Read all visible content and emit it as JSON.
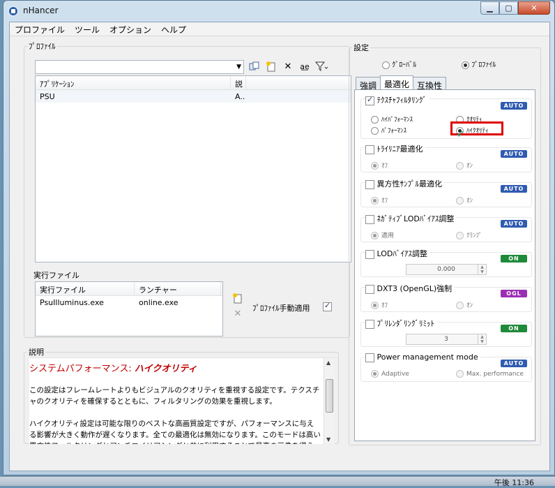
{
  "window": {
    "title": "nHancer",
    "min_label": "▁",
    "max_label": "▢",
    "close_label": "✕"
  },
  "menu": [
    {
      "label": "プロファイル"
    },
    {
      "label": "ツール"
    },
    {
      "label": "オプション"
    },
    {
      "label": "ヘルプ"
    }
  ],
  "profile": {
    "legend": "ﾌﾟﾛﾌｧｲﾙ",
    "combo_value": "",
    "columns": [
      "ｱﾌﾟﾘｹｰｼｮﾝ",
      "説"
    ],
    "rows": [
      {
        "app": "PSU",
        "desc": "A.."
      }
    ]
  },
  "exe": {
    "title": "実行ファイル",
    "columns": [
      "実行ファイル",
      "ランチャー"
    ],
    "rows": [
      {
        "exe": "PsuIlluminus.exe",
        "launcher": "online.exe"
      }
    ],
    "manual_label": "ﾌﾟﾛﾌｧｲﾙ手動適用",
    "manual_checked": true
  },
  "description": {
    "legend": "説明",
    "heading_prefix": "システムパフォーマンス: ",
    "heading_value": "ハイクオリティ",
    "p1": "この設定はフレームレートよりもビジュアルのクオリティを重視する設定です。テクスチャのクオリティを確保するとともに、フィルタリングの効果を重視します。",
    "p2": "ハイクオリティ設定は可能な限りのベストな高画質設定ですが、パフォーマンスに与える影響が大きく動作が遅くなります。全ての最適化は無効になります。このモードは高い異方性フィルタリングとアンチエイリアシングと共に利用することで最高の画像を得られます。"
  },
  "settings": {
    "legend": "設定",
    "scope_global": "ｸﾞﾛｰﾊﾞﾙ",
    "scope_profile": "ﾌﾟﾛﾌｧｲﾙ",
    "scope_selected": "profile",
    "tabs": [
      {
        "label": "強調",
        "active": false
      },
      {
        "label": "最適化",
        "active": true
      },
      {
        "label": "互換性",
        "active": false
      }
    ],
    "items": [
      {
        "title": "ﾃｸｽﾁｬﾌｨﾙﾀﾘﾝｸﾞ",
        "checked": true,
        "badge": "AUTO",
        "options": [
          "ﾊｲﾊﾟﾌｫｰﾏﾝｽ",
          "ｸｵﾘﾃｨ",
          "ﾊﾟﾌｫｰﾏﾝｽ",
          "ﾊｲｸｵﾘﾃｨ"
        ],
        "selected": "ﾊｲｸｵﾘﾃｨ"
      },
      {
        "title": "ﾄﾗｲﾘﾆｱ最適化",
        "checked": false,
        "badge": "AUTO",
        "options": [
          "ｵﾌ",
          "ｵﾝ"
        ],
        "selected": "ｵﾌ"
      },
      {
        "title": "異方性ｻﾝﾌﾟﾙ最適化",
        "checked": false,
        "badge": "AUTO",
        "options": [
          "ｵﾌ",
          "ｵﾝ"
        ],
        "selected": "ｵﾌ"
      },
      {
        "title": "ﾈｶﾞﾃｨﾌﾞLODﾊﾞｲｱｽ調整",
        "checked": false,
        "badge": "AUTO",
        "options": [
          "適用",
          "ｸﾗﾝﾌﾟ"
        ],
        "selected": "適用"
      },
      {
        "title": "LODﾊﾞｲｱｽ調整",
        "checked": false,
        "badge": "ON",
        "value": "0.000"
      },
      {
        "title": "DXT3 (OpenGL)強制",
        "checked": false,
        "badge": "OGL",
        "options": [
          "ｵﾌ",
          "ｵﾝ"
        ],
        "selected": "ｵﾌ"
      },
      {
        "title": "ﾌﾟﾘﾚﾝﾀﾞﾘﾝｸﾞﾘﾐｯﾄ",
        "checked": false,
        "badge": "ON",
        "value": "3"
      },
      {
        "title": "Power management mode",
        "checked": false,
        "badge": "AUTO",
        "options": [
          "Adaptive",
          "Max. performance"
        ],
        "selected": "Adaptive"
      }
    ]
  },
  "taskbar": {
    "clock": "午後 11:36"
  },
  "colors": {
    "accent_red": "#c00000",
    "badge_auto": "#2f5bb0",
    "badge_on": "#1f8a3a",
    "badge_ogl": "#9b2fb4",
    "highlight": "#e00000"
  }
}
